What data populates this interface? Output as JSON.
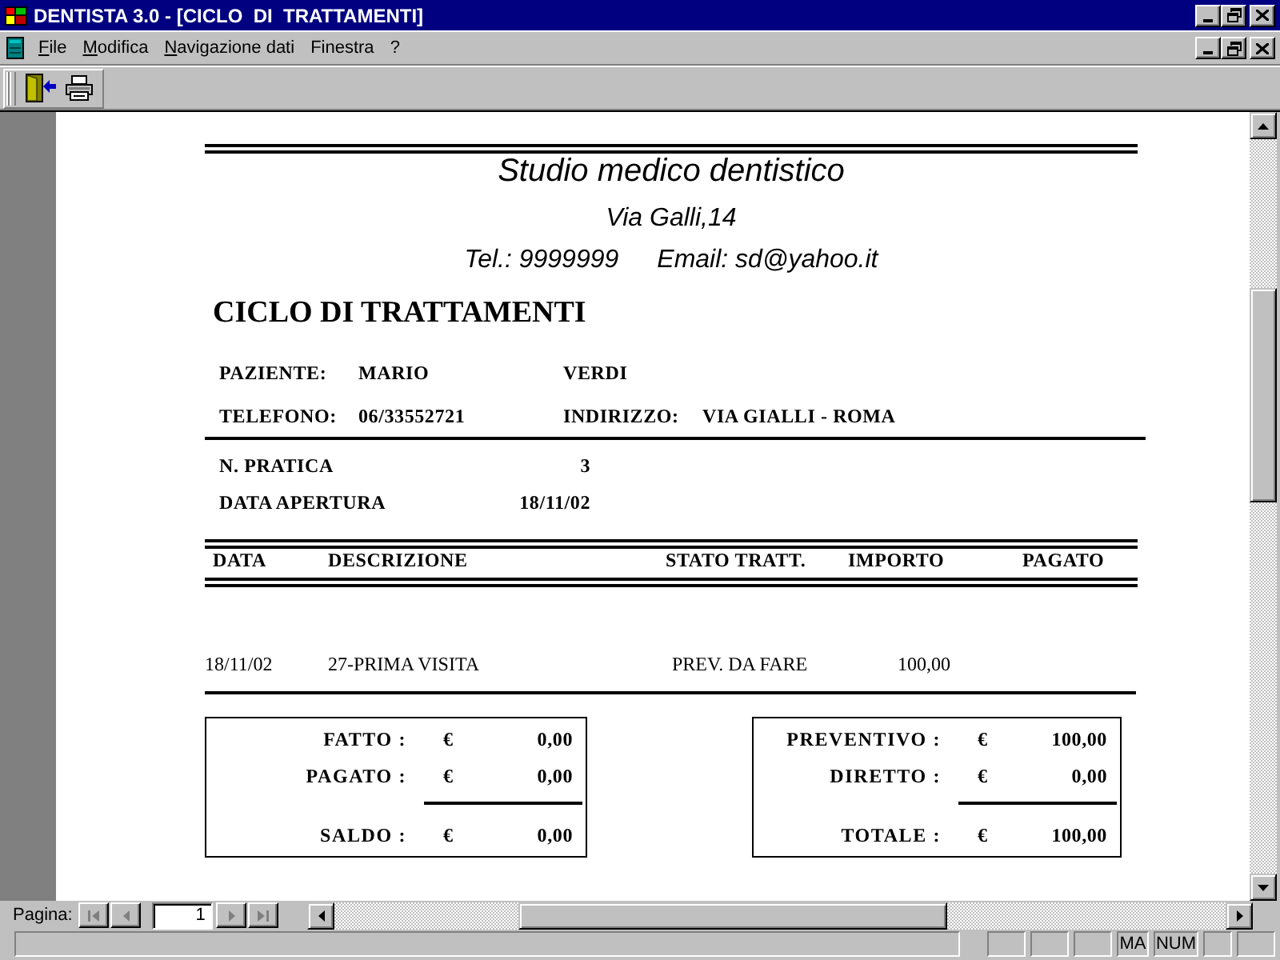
{
  "window": {
    "title": "DENTISTA 3.0 - [CICLO  DI  TRATTAMENTI]"
  },
  "menu": [
    {
      "label": "File",
      "mnemonic": true
    },
    {
      "label": "Modifica",
      "mnemonic": true
    },
    {
      "label": "Navigazione dati",
      "mnemonic": true
    },
    {
      "label": "Finestra",
      "mnemonic": false
    },
    {
      "label": "?",
      "mnemonic": false
    }
  ],
  "report": {
    "clinic": {
      "name": "Studio medico dentistico",
      "address": "Via Galli,14",
      "phone": "Tel.: 9999999",
      "email": "Email: sd@yahoo.it"
    },
    "title": "CICLO DI TRATTAMENTI",
    "patient": {
      "label": "PAZIENTE:",
      "first_name": "MARIO",
      "last_name": "VERDI"
    },
    "contact": {
      "phone_label": "TELEFONO:",
      "phone": "06/33552721",
      "address_label": "INDIRIZZO:",
      "address": "VIA GIALLI - ROMA"
    },
    "practice": [
      {
        "label": "N. PRATICA",
        "value": "3"
      },
      {
        "label": "DATA APERTURA",
        "value": "18/11/02"
      }
    ],
    "table": {
      "columns": [
        "DATA",
        "DESCRIZIONE",
        "STATO TRATT.",
        "IMPORTO",
        "PAGATO"
      ],
      "rows": [
        {
          "cells": [
            "18/11/02",
            "27-PRIMA VISITA",
            "PREV. DA FARE",
            "100,00"
          ]
        }
      ]
    },
    "summaries": [
      {
        "lines": [
          {
            "label": "FATTO :",
            "currency": "€",
            "amount": "0,00"
          },
          {
            "label": "PAGATO :",
            "currency": "€",
            "amount": "0,00"
          }
        ],
        "total": {
          "label": "SALDO :",
          "currency": "€",
          "amount": "0,00"
        }
      },
      {
        "lines": [
          {
            "label": "PREVENTIVO :",
            "currency": "€",
            "amount": "100,00"
          },
          {
            "label": "DIRETTO :",
            "currency": "€",
            "amount": "0,00"
          }
        ],
        "total": {
          "label": "TOTALE :",
          "currency": "€",
          "amount": "100,00"
        }
      }
    ]
  },
  "pager": {
    "label": "Pagina:",
    "page": "1",
    "buttons": [
      {
        "kind": "first",
        "disabled": true
      },
      {
        "kind": "previous",
        "disabled": true
      },
      {
        "kind": "next",
        "disabled": true
      },
      {
        "kind": "last",
        "disabled": true
      }
    ]
  },
  "status_bar": {
    "indicators": [
      "MA",
      "NUM"
    ]
  }
}
